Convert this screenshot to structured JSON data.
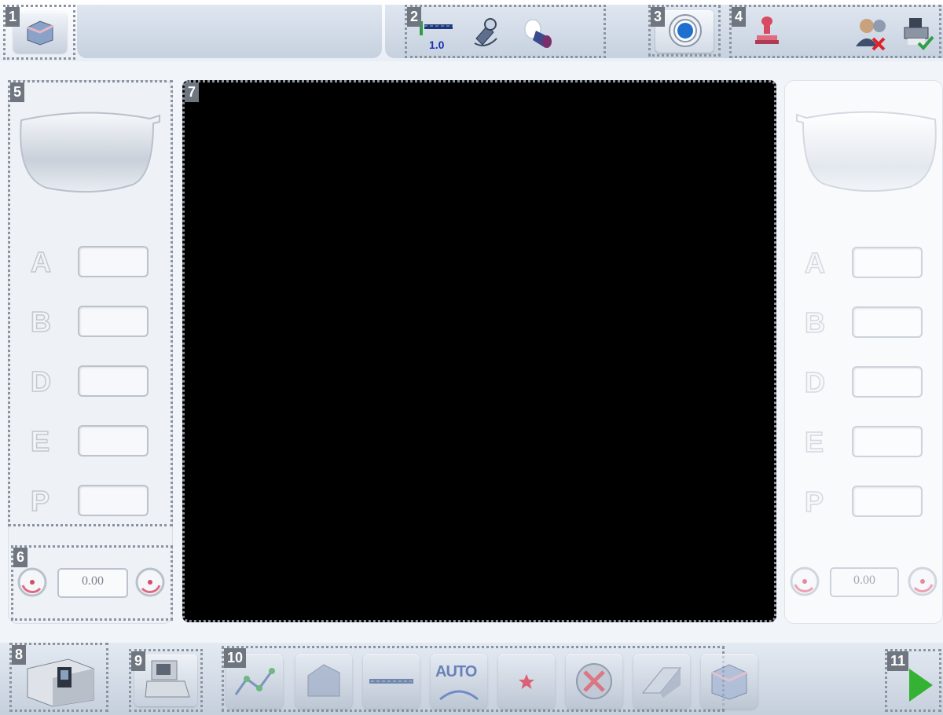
{
  "top_bar": {
    "badges": {
      "b1": "1",
      "b2": "2",
      "b3": "3",
      "b4": "4"
    },
    "drill_value": "1.0",
    "icons": [
      "lens-shape-icon",
      "drill-bit-icon",
      "satellite-icon",
      "suction-cup-icon",
      "target-icon",
      "stamp-icon",
      "user-cancel-icon",
      "print-ok-icon"
    ]
  },
  "left_panel": {
    "badge": "5",
    "fields": [
      {
        "letter": "A"
      },
      {
        "letter": "B"
      },
      {
        "letter": "D"
      },
      {
        "letter": "E"
      },
      {
        "letter": "P"
      }
    ]
  },
  "left_rotation": {
    "badge": "6",
    "value": "0.00"
  },
  "display": {
    "badge": "7"
  },
  "right_panel": {
    "fields": [
      {
        "letter": "A"
      },
      {
        "letter": "B"
      },
      {
        "letter": "D"
      },
      {
        "letter": "E"
      },
      {
        "letter": "P"
      }
    ],
    "rotation_value": "0.00"
  },
  "bottom_bar": {
    "badges": {
      "b8": "8",
      "b9": "9",
      "b10": "10",
      "b11": "11"
    },
    "tool_label_auto": "AUTO",
    "icons": [
      "edger-machine-icon",
      "tracer-icon",
      "graph-icon",
      "bevel-icon",
      "groove-icon",
      "auto-icon",
      "star-icon",
      "cancel-icon",
      "polish-icon",
      "safety-bevel-icon",
      "play-icon"
    ]
  },
  "colors": {
    "background": "#f1f4f8",
    "display": "#000000",
    "accent_blue": "#1f6fd1",
    "play_green": "#34b233"
  }
}
